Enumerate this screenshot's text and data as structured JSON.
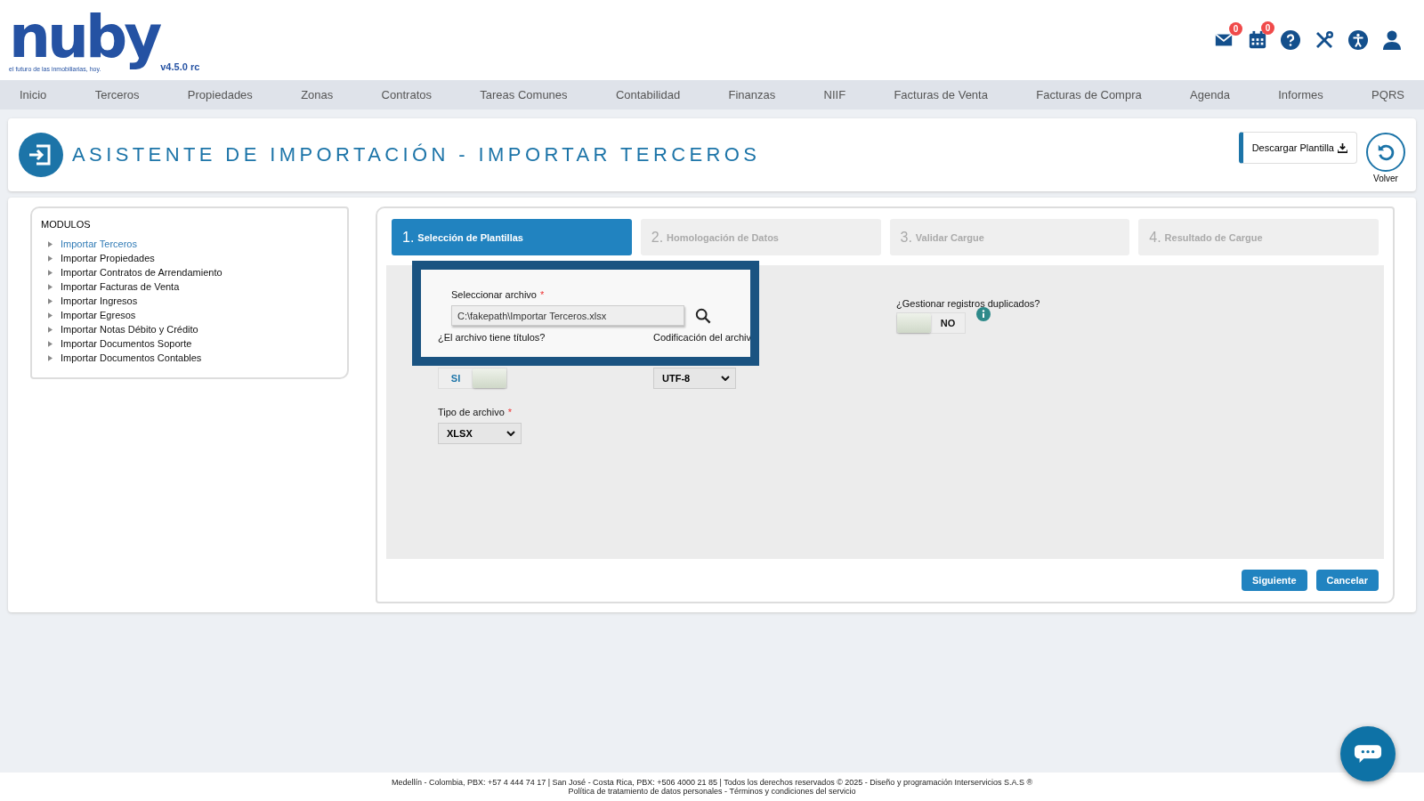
{
  "header": {
    "logo": "nuby",
    "tagline": "el futuro de las inmobiliarias, hoy.",
    "version": "v4.5.0 rc",
    "mail_badge": "0",
    "calendar_badge": "0"
  },
  "nav": [
    "Inicio",
    "Terceros",
    "Propiedades",
    "Zonas",
    "Contratos",
    "Tareas Comunes",
    "Contabilidad",
    "Finanzas",
    "NIIF",
    "Facturas de Venta",
    "Facturas de Compra",
    "Agenda",
    "Informes",
    "PQRS"
  ],
  "page_title": "ASISTENTE DE IMPORTACIÓN - IMPORTAR TERCEROS",
  "download_button": "Descargar Plantilla",
  "back_label": "Volver",
  "modules": {
    "title": "MODULOS",
    "items": [
      {
        "label": "Importar Terceros",
        "selected": true
      },
      {
        "label": "Importar Propiedades",
        "selected": false
      },
      {
        "label": "Importar Contratos de Arrendamiento",
        "selected": false
      },
      {
        "label": "Importar Facturas de Venta",
        "selected": false
      },
      {
        "label": "Importar Ingresos",
        "selected": false
      },
      {
        "label": "Importar Egresos",
        "selected": false
      },
      {
        "label": "Importar Notas Débito y Crédito",
        "selected": false
      },
      {
        "label": "Importar Documentos Soporte",
        "selected": false
      },
      {
        "label": "Importar Documentos Contables",
        "selected": false
      }
    ]
  },
  "steps": [
    {
      "number": "1.",
      "label": "Selección de Plantillas",
      "selected": true
    },
    {
      "number": "2.",
      "label": "Homologación de Datos",
      "selected": false
    },
    {
      "number": "3.",
      "label": "Validar Cargue",
      "selected": false
    },
    {
      "number": "4.",
      "label": "Resultado de Cargue",
      "selected": false
    }
  ],
  "form": {
    "file": {
      "label": "Seleccionar archivo",
      "required_mark": "*",
      "value": "C:\\fakepath\\Importar Terceros.xlsx"
    },
    "has_titles": {
      "label": "¿El archivo tiene títulos?",
      "on": true,
      "text": "SI"
    },
    "encoding": {
      "label": "Codificación del archiv",
      "value": "UTF-8"
    },
    "file_type": {
      "label": "Tipo de archivo",
      "required_mark": "*",
      "value": "XLSX"
    },
    "duplicates": {
      "label": "¿Gestionar registros duplicados?",
      "on": false,
      "text": "NO"
    }
  },
  "buttons": [
    "Siguiente",
    "Cancelar"
  ],
  "footer": {
    "line1": "Medellín - Colombia, PBX: +57 4 444 74 17 | San José - Costa Rica, PBX: +506 4000 21 85 | Todos los derechos reservados © 2025 - Diseño y programación Interservicios S.A.S ®",
    "line2": "Política de tratamiento de datos personales - Términos y condiciones del servicio"
  }
}
